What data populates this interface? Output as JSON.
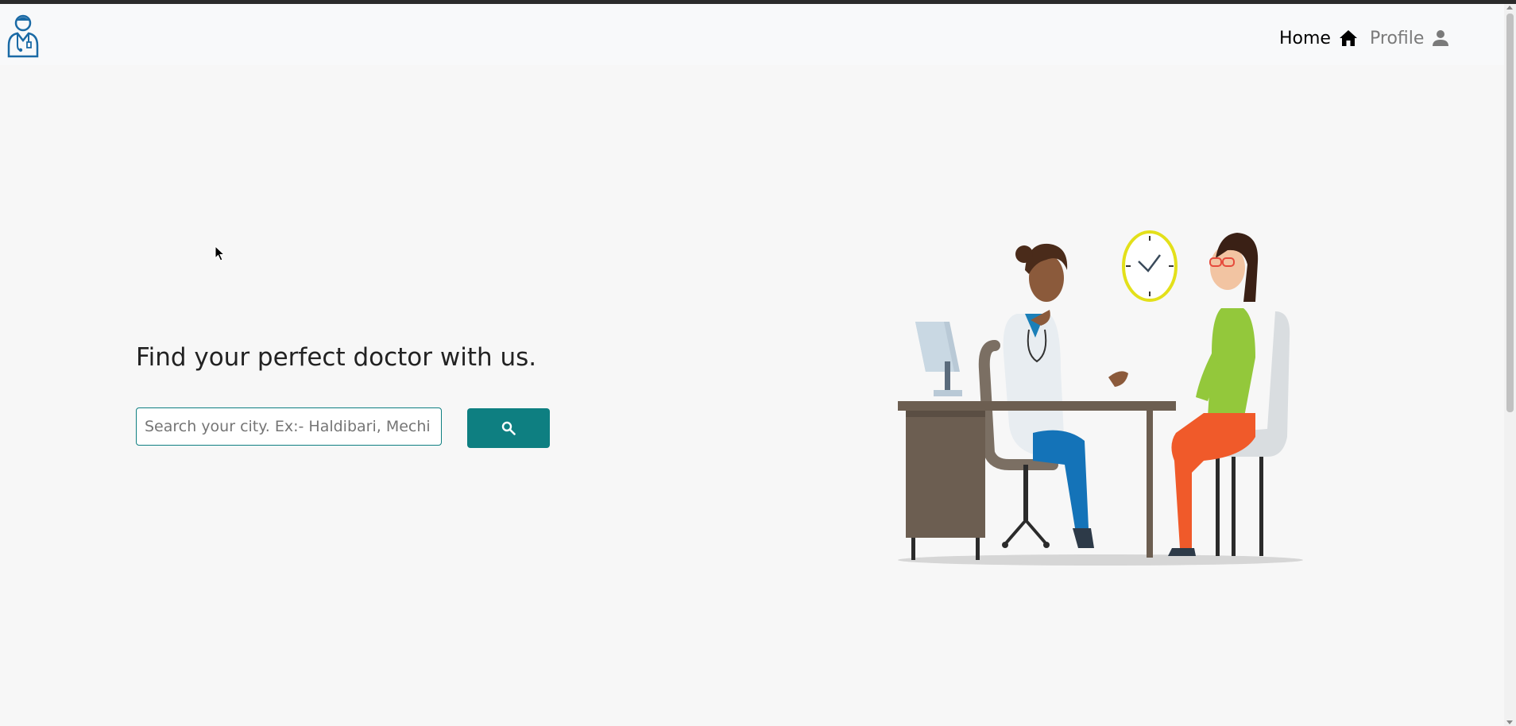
{
  "nav": {
    "home_label": "Home",
    "profile_label": "Profile",
    "logo_icon": "doctor-logo-icon",
    "home_icon": "home-icon",
    "profile_icon": "person-icon"
  },
  "hero": {
    "headline": "Find your perfect doctor with us.",
    "search_placeholder": "Search your city. Ex:- Haldibari, Mechi",
    "search_icon": "search-icon",
    "illustration": "doctor-patient-consultation-illustration"
  },
  "colors": {
    "accent": "#0e7f81",
    "navbar_bg": "#f8f9fa",
    "page_bg": "#f7f7f7",
    "logo": "#1a6aa5"
  }
}
